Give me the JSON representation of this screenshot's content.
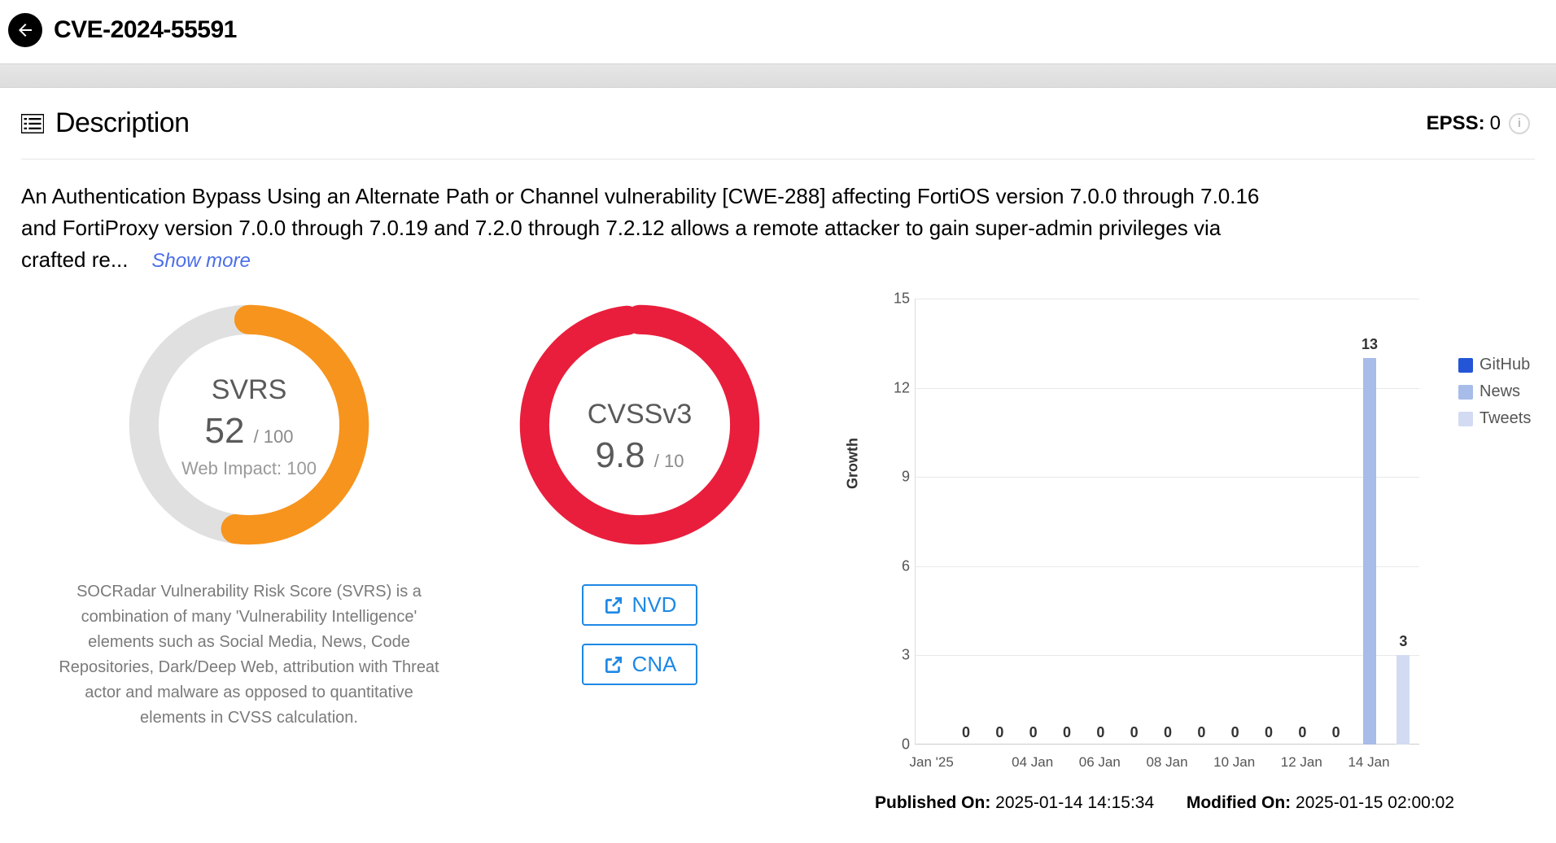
{
  "header": {
    "cve_id": "CVE-2024-55591"
  },
  "description": {
    "section_title": "Description",
    "epss_label": "EPSS:",
    "epss_value": "0",
    "body": "An Authentication Bypass Using an Alternate Path or Channel vulnerability [CWE-288] affecting FortiOS version 7.0.0 through 7.0.16 and FortiProxy version 7.0.0 through 7.0.19 and 7.2.0 through 7.2.12 allows a remote attacker to gain super-admin privileges via crafted re...",
    "show_more": "Show more"
  },
  "svrs": {
    "label": "SVRS",
    "value": 52,
    "max": 100,
    "web_impact_label": "Web Impact:",
    "web_impact_value": 100,
    "explain": "SOCRadar Vulnerability Risk Score (SVRS) is a combination of many 'Vulnerability Intelligence' elements such as Social Media, News, Code Repositories, Dark/Deep Web, attribution with Threat actor and malware as opposed to quantitative elements in CVSS calculation.",
    "color": "#f7941d"
  },
  "cvss": {
    "label": "CVSSv3",
    "value": 9.8,
    "max": 10,
    "color": "#e91e3c",
    "links": {
      "nvd": "NVD",
      "cna": "CNA"
    }
  },
  "chart_data": {
    "type": "bar",
    "title": "Growth",
    "ylabel": "Growth",
    "xlabel": "",
    "ylim": [
      0,
      15
    ],
    "y_ticks": [
      0,
      3,
      6,
      9,
      12,
      15
    ],
    "categories": [
      "Jan '25",
      "",
      "",
      "04 Jan",
      "",
      "06 Jan",
      "",
      "08 Jan",
      "",
      "10 Jan",
      "",
      "12 Jan",
      "",
      "14 Jan",
      ""
    ],
    "x_tick_show": [
      true,
      false,
      false,
      true,
      false,
      true,
      false,
      true,
      false,
      true,
      false,
      true,
      false,
      true,
      false
    ],
    "series": [
      {
        "name": "GitHub",
        "color": "#2455d6",
        "values": [
          0,
          0,
          0,
          0,
          0,
          0,
          0,
          0,
          0,
          0,
          0,
          0,
          0,
          0,
          0
        ]
      },
      {
        "name": "News",
        "color": "#a7bce8",
        "values": [
          0,
          0,
          0,
          0,
          0,
          0,
          0,
          0,
          0,
          0,
          0,
          0,
          0,
          13,
          0
        ]
      },
      {
        "name": "Tweets",
        "color": "#d2dbf2",
        "values": [
          0,
          0,
          0,
          0,
          0,
          0,
          0,
          0,
          0,
          0,
          0,
          0,
          0,
          0,
          3
        ]
      }
    ],
    "display_bars": [
      {
        "series": "News",
        "category_index": 13,
        "value": 13
      },
      {
        "series": "Tweets",
        "category_index": 14,
        "value": 3
      }
    ],
    "zero_label_indices": [
      1,
      2,
      3,
      4,
      5,
      6,
      7,
      8,
      9,
      10,
      11,
      12
    ]
  },
  "timestamps": {
    "published_label": "Published On:",
    "published_value": "2025-01-14 14:15:34",
    "modified_label": "Modified On:",
    "modified_value": "2025-01-15 02:00:02"
  },
  "legend": {
    "github": "GitHub",
    "news": "News",
    "tweets": "Tweets"
  }
}
